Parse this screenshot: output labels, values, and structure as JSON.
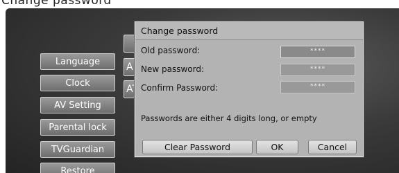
{
  "caption": "Change password",
  "menu": {
    "items": [
      {
        "label": "Language"
      },
      {
        "label": "Clock"
      },
      {
        "label": "AV Setting"
      },
      {
        "label": "Parental lock"
      },
      {
        "label": "TVGuardian"
      },
      {
        "label": "Restore"
      }
    ]
  },
  "submenu": {
    "items": [
      {
        "label": ""
      },
      {
        "label": "A"
      },
      {
        "label": "AT"
      }
    ]
  },
  "dialog": {
    "title": "Change password",
    "fields": [
      {
        "label": "Old password:",
        "value": "****"
      },
      {
        "label": "New password:",
        "value": "****"
      },
      {
        "label": "Confirm Password:",
        "value": "****"
      }
    ],
    "hint": "Passwords are either 4 digits long, or empty",
    "buttons": {
      "clear": "Clear Password",
      "ok": "OK",
      "cancel": "Cancel"
    }
  }
}
